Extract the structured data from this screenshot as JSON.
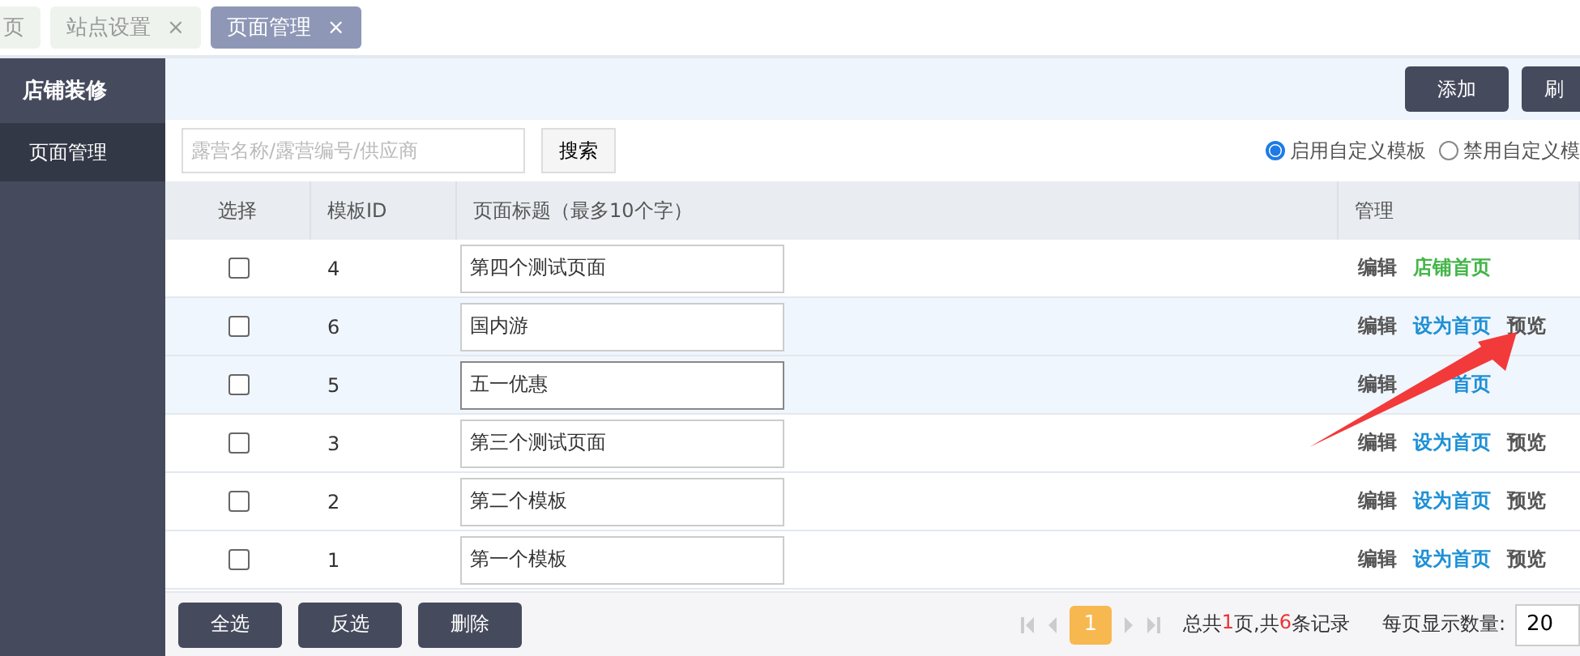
{
  "tabs": [
    {
      "label": "页",
      "selected": false
    },
    {
      "label": "站点设置",
      "close": "×",
      "selected": false
    },
    {
      "label": "页面管理",
      "close": "×",
      "selected": true
    }
  ],
  "sidebar": {
    "title": "店铺装修",
    "items": [
      {
        "label": "页面管理",
        "selected": true
      }
    ]
  },
  "toolbar": {
    "buttons": [
      "添加",
      "刷"
    ]
  },
  "search": {
    "placeholder": "露营名称/露营编号/供应商",
    "button": "搜索"
  },
  "template_mode": [
    {
      "label": "启用自定义模板",
      "selected": true
    },
    {
      "label": "禁用自定义模",
      "selected": false
    }
  ],
  "table": {
    "columns": [
      "选择",
      "模板ID",
      "页面标题（最多10个字）",
      "管理"
    ],
    "rows": [
      {
        "checked": false,
        "id": "4",
        "title": "第四个测试页面",
        "focused": false,
        "highlighted": false,
        "actions": [
          {
            "label": "编辑",
            "kind": "edit"
          },
          {
            "label": "店铺首页",
            "kind": "home"
          }
        ]
      },
      {
        "checked": false,
        "id": "6",
        "title": "国内游",
        "focused": false,
        "highlighted": true,
        "actions": [
          {
            "label": "编辑",
            "kind": "edit"
          },
          {
            "label": "设为首页",
            "kind": "link"
          },
          {
            "label": "预览",
            "kind": "edit"
          }
        ]
      },
      {
        "checked": false,
        "id": "5",
        "title": "五一优惠",
        "focused": true,
        "highlighted": true,
        "actions": [
          {
            "label": "编辑",
            "kind": "edit"
          },
          {
            "label": "首页",
            "kind": "covered-link"
          }
        ]
      },
      {
        "checked": false,
        "id": "3",
        "title": "第三个测试页面",
        "focused": false,
        "highlighted": false,
        "actions": [
          {
            "label": "编辑",
            "kind": "edit"
          },
          {
            "label": "设为首页",
            "kind": "link"
          },
          {
            "label": "预览",
            "kind": "edit"
          }
        ]
      },
      {
        "checked": false,
        "id": "2",
        "title": "第二个模板",
        "focused": false,
        "highlighted": false,
        "actions": [
          {
            "label": "编辑",
            "kind": "edit"
          },
          {
            "label": "设为首页",
            "kind": "link"
          },
          {
            "label": "预览",
            "kind": "edit"
          }
        ]
      },
      {
        "checked": false,
        "id": "1",
        "title": "第一个模板",
        "focused": false,
        "highlighted": false,
        "actions": [
          {
            "label": "编辑",
            "kind": "edit"
          },
          {
            "label": "设为首页",
            "kind": "link"
          },
          {
            "label": "预览",
            "kind": "edit"
          }
        ]
      }
    ]
  },
  "footer_buttons": [
    "全选",
    "反选",
    "删除"
  ],
  "pagination": {
    "current": "1",
    "summary": [
      {
        "text": "总共",
        "kind": "plain"
      },
      {
        "text": "1",
        "kind": "number"
      },
      {
        "text": "页,共",
        "kind": "plain"
      },
      {
        "text": "6",
        "kind": "number"
      },
      {
        "text": "条记录",
        "kind": "plain"
      }
    ],
    "page_size_label": "每页显示数量:",
    "page_size": "20"
  }
}
